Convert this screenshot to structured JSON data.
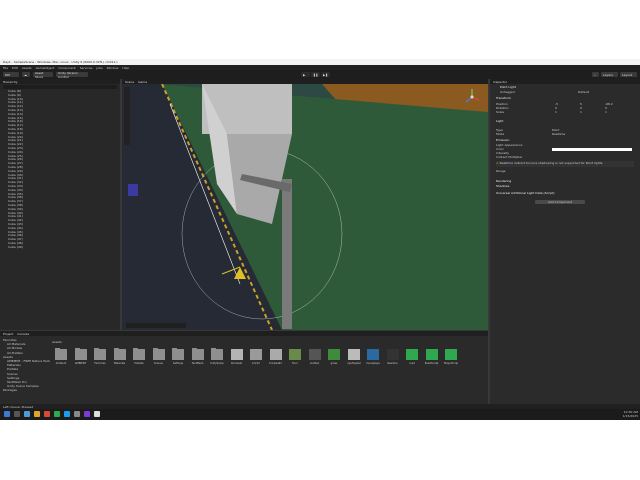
{
  "window": {
    "title": "Day1 - SampleScene - Windows, Mac, Linux - Unity 6 (6000.0.32f1) <DX11>"
  },
  "menu": [
    "File",
    "Edit",
    "Assets",
    "GameObject",
    "Component",
    "Services",
    "Jobs",
    "Window",
    "Help"
  ],
  "toolbar": {
    "account_label": "DM",
    "asset_store": "Asset Store",
    "unity_version": "Unity Version Control",
    "layers": "Layers",
    "layout": "Layout"
  },
  "hierarchy": {
    "tab": "Hierarchy",
    "items": [
      "Cube (8)",
      "Cube (9)",
      "Cube (10)",
      "Cube (11)",
      "Cube (12)",
      "Cube (13)",
      "Cube (14)",
      "Cube (15)",
      "Cube (16)",
      "Cube (17)",
      "Cube (18)",
      "Cube (19)",
      "Cube (20)",
      "Cube (21)",
      "Cube (22)",
      "Cube (23)",
      "Cube (24)",
      "Cube (25)",
      "Cube (26)",
      "Cube (27)",
      "Cube (28)",
      "Cube (29)",
      "Cube (30)",
      "Cube (31)",
      "Cube (32)",
      "Cube (33)",
      "Cube (34)",
      "Cube (35)",
      "Cube (36)",
      "Cube (37)",
      "Cube (38)",
      "Cube (39)",
      "Cube (40)",
      "Cube (41)",
      "Cube (42)",
      "Cube (43)",
      "Cube (44)",
      "Cube (45)",
      "Cube (46)",
      "Cube (47)",
      "Cube (48)",
      "Cube (49)"
    ]
  },
  "scene": {
    "tabs": [
      "Scene",
      "Game"
    ]
  },
  "inspector": {
    "tab": "Inspector",
    "object_name": "Point Light",
    "tag_label": "Untagged",
    "layer_label": "Default",
    "transform": {
      "title": "Transform",
      "rows": [
        {
          "label": "Position",
          "x": "-5",
          "y": "5",
          "z": "-68.2"
        },
        {
          "label": "Rotation",
          "x": "0",
          "y": "0",
          "z": "0"
        },
        {
          "label": "Scale",
          "x": "1",
          "y": "1",
          "z": "1"
        }
      ]
    },
    "light": {
      "title": "Light",
      "rows": [
        {
          "label": "Type",
          "value": "Point"
        },
        {
          "label": "Mode",
          "value": "Realtime"
        }
      ]
    },
    "emission": {
      "title": "Emission",
      "rows": [
        "Light Appearance",
        "Color",
        "Intensity",
        "Indirect Multiplier"
      ]
    },
    "range_label": "Range",
    "warning": "Realtime indirect bounce shadowing is not supported for Point lights.",
    "sections": [
      "Rendering",
      "Shadows"
    ],
    "component": "Universal Additional Light Data (Script)",
    "add_component": "Add Component"
  },
  "project": {
    "tabs": [
      "Project",
      "Console"
    ],
    "tree": [
      "Favorites",
      "All Materials",
      "All Models",
      "All Prefabs",
      "Assets",
      "AMBIENT - FREE Nature Pack",
      "Materials",
      "Prefabs",
      "Scenes",
      "Settings",
      "TextMesh Pro",
      "Unity Scene Samples",
      "Packages"
    ],
    "breadcrumb": "Assets",
    "assets": [
      "Ambient",
      "AMBIENT",
      "Factories",
      "Materials",
      "Prefabs",
      "Scenes",
      "Settings",
      "TextMesh",
      "UnitySamples",
      "brickwall",
      "brick2",
      "brickwall2",
      "floor",
      "roadtex",
      "grass",
      "InputSystem",
      "moveplayer",
      "Readme",
      "road",
      "RoadScript",
      "PlayerScript"
    ]
  },
  "status": {
    "text": "Left mouse: Pressed"
  },
  "taskbar": {
    "time": "10:30 AM",
    "date": "1/15/2025"
  },
  "colors": {
    "unity_dark": "#383838",
    "ground_green": "#2f5a3a",
    "road": "#2a2a35",
    "accent_blue": "#3a79d4",
    "checker_orange": "#8a5a20"
  }
}
